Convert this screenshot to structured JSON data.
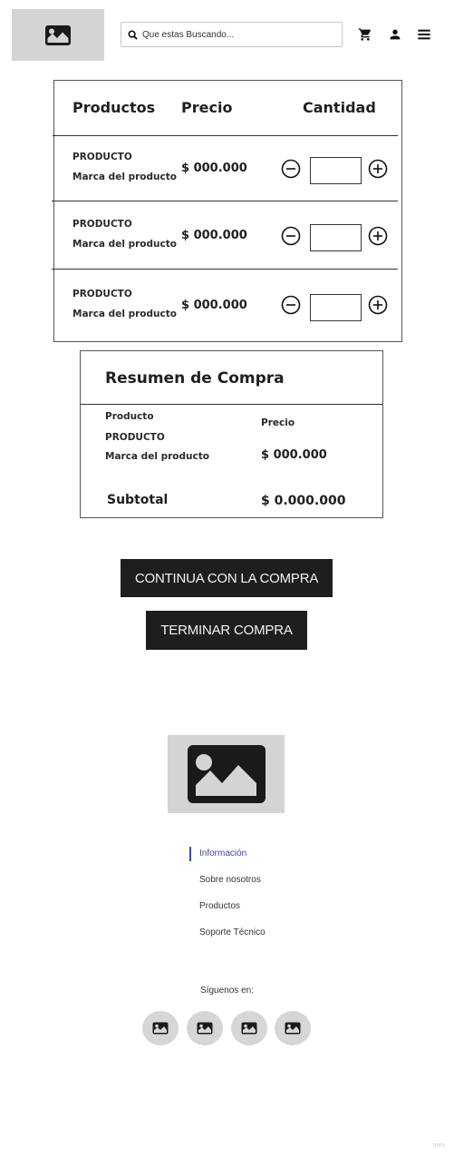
{
  "header": {
    "logo_icon": "image-icon",
    "search": {
      "placeholder": "Que estas Buscando..."
    },
    "icons": [
      "cart-icon",
      "user-icon",
      "menu-icon"
    ]
  },
  "cart": {
    "columns": {
      "products": "Productos",
      "price": "Precio",
      "quantity": "Cantidad"
    },
    "items": [
      {
        "name": "PRODUCTO",
        "brand": "Marca del producto",
        "price": "$ 000.000",
        "quantity": ""
      },
      {
        "name": "PRODUCTO",
        "brand": "Marca del producto",
        "price": "$ 000.000",
        "quantity": ""
      },
      {
        "name": "PRODUCTO",
        "brand": "Marca del producto",
        "price": "$ 000.000",
        "quantity": ""
      }
    ]
  },
  "summary": {
    "title": "Resumen de Compra",
    "product_label": "Producto",
    "price_label": "Precio",
    "item_name": "PRODUCTO",
    "item_brand": "Marca del producto",
    "item_price": "$ 000.000",
    "subtotal_label": "Subtotal",
    "subtotal_value": "$ 0.000.000"
  },
  "actions": {
    "continue_label": "CONTINUA CON LA COMPRA",
    "finish_label": "TERMINAR COMPRA"
  },
  "footer": {
    "logo_icon": "image-icon",
    "links": [
      "Información",
      "Sobre nosotros",
      "Productos",
      "Soporte Técnico"
    ],
    "follow_label": "Síguenos en:",
    "social_icons": [
      "image-icon",
      "image-icon",
      "image-icon",
      "image-icon"
    ]
  },
  "watermark": "miro",
  "colors": {
    "button_bg": "#1e1e1e",
    "placeholder_bg": "#d4d4d4",
    "active_link": "#3a4a9a"
  }
}
